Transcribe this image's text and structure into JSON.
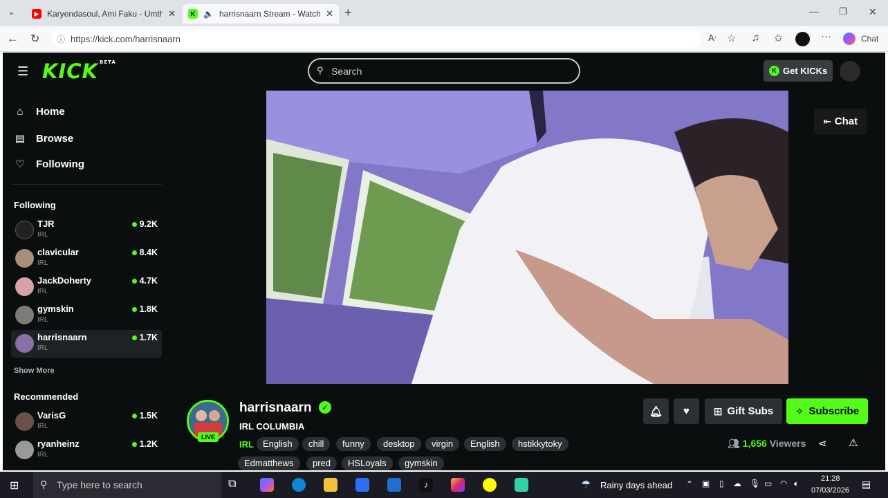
{
  "browser": {
    "tabs": [
      {
        "title": "Karyendasoul, Ami Faku - Umthandazo"
      },
      {
        "title": "harrisnaarn Stream - Watch Live on Kick"
      }
    ],
    "url": "https://kick.com/harrisnaarn",
    "chat_label": "Chat"
  },
  "kick": {
    "search_placeholder": "Search",
    "get_kicks": "Get KICKs",
    "nav": [
      {
        "label": "Home",
        "icon": "home-icon"
      },
      {
        "label": "Browse",
        "icon": "browse-icon"
      },
      {
        "label": "Following",
        "icon": "heart-icon"
      }
    ],
    "following_title": "Following",
    "following": [
      {
        "name": "TJR",
        "category": "IRL",
        "viewers": "9.2K",
        "color": "#222"
      },
      {
        "name": "clavicular",
        "category": "IRL",
        "viewers": "8.4K",
        "color": "#a88f7a"
      },
      {
        "name": "JackDoherty",
        "category": "IRL",
        "viewers": "4.7K",
        "color": "#d9a0a8"
      },
      {
        "name": "gymskin",
        "category": "IRL",
        "viewers": "1.8K",
        "color": "#7c7c74"
      },
      {
        "name": "harrisnaarn",
        "category": "IRL",
        "viewers": "1.7K",
        "color": "#8a6fa8"
      }
    ],
    "show_more": "Show More",
    "recommended_title": "Recommended",
    "recommended": [
      {
        "name": "VarisG",
        "category": "IRL",
        "viewers": "1.5K",
        "color": "#6a5048"
      },
      {
        "name": "ryanheinz",
        "category": "IRL",
        "viewers": "1.2K",
        "color": "#9a9a9a"
      }
    ],
    "chat_button": "Chat",
    "channel": {
      "name": "harrisnaarn",
      "title": "IRL COLUMBIA",
      "live": "LIVE",
      "category": "IRL",
      "tags": [
        "English",
        "chill",
        "funny",
        "desktop",
        "virgin",
        "English",
        "hstikkytoky",
        "Edmatthews",
        "pred",
        "HSLoyals",
        "gymskin"
      ],
      "viewers": "1,656",
      "viewers_label": "Viewers",
      "gift_subs": "Gift Subs",
      "subscribe": "Subscribe"
    }
  },
  "taskbar": {
    "search_placeholder": "Type here to search",
    "weather": "Rainy days ahead",
    "time": "21:28",
    "date": "07/03/2026"
  },
  "colors": {
    "accent": "#53fc18",
    "background": "#0b0e0f"
  }
}
